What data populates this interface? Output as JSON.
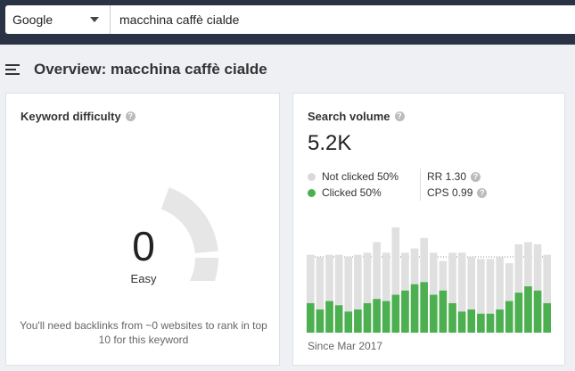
{
  "search": {
    "engine": "Google",
    "query": "macchina caffè cialde"
  },
  "header": {
    "title": "Overview: macchina caffè cialde"
  },
  "keyword_difficulty": {
    "title": "Keyword difficulty",
    "value": "0",
    "label": "Easy",
    "score": 0,
    "note": "You'll need backlinks from ~0 websites to rank in top 10 for this keyword"
  },
  "search_volume": {
    "title": "Search volume",
    "value": "5.2K",
    "legend": [
      {
        "label": "Not clicked 50%",
        "color": "#d9d9d9"
      },
      {
        "label": "Clicked 50%",
        "color": "#4caf50"
      }
    ],
    "rr": "RR 1.30",
    "cps": "CPS 0.99",
    "since": "Since Mar 2017"
  },
  "colors": {
    "topbar": "#2a3346",
    "gauge_track": "#e6e6e6",
    "not_clicked": "#e0e0e0",
    "clicked": "#4caf50"
  },
  "chart_data": {
    "type": "bar",
    "stacked": true,
    "ylim": [
      0,
      1
    ],
    "series": [
      {
        "values": [
          0.74,
          0.72,
          0.74,
          0.74,
          0.72,
          0.74,
          0.76,
          0.86,
          0.76,
          1.0,
          0.76,
          0.8,
          0.9,
          0.76,
          0.68,
          0.76,
          0.76,
          0.72,
          0.7,
          0.7,
          0.72,
          0.66,
          0.84,
          0.86,
          0.84,
          0.74
        ]
      },
      {
        "values": [
          0.28,
          0.22,
          0.3,
          0.26,
          0.2,
          0.22,
          0.28,
          0.32,
          0.3,
          0.36,
          0.4,
          0.46,
          0.48,
          0.36,
          0.4,
          0.28,
          0.2,
          0.22,
          0.18,
          0.18,
          0.22,
          0.3,
          0.38,
          0.44,
          0.4,
          0.28
        ]
      }
    ]
  }
}
